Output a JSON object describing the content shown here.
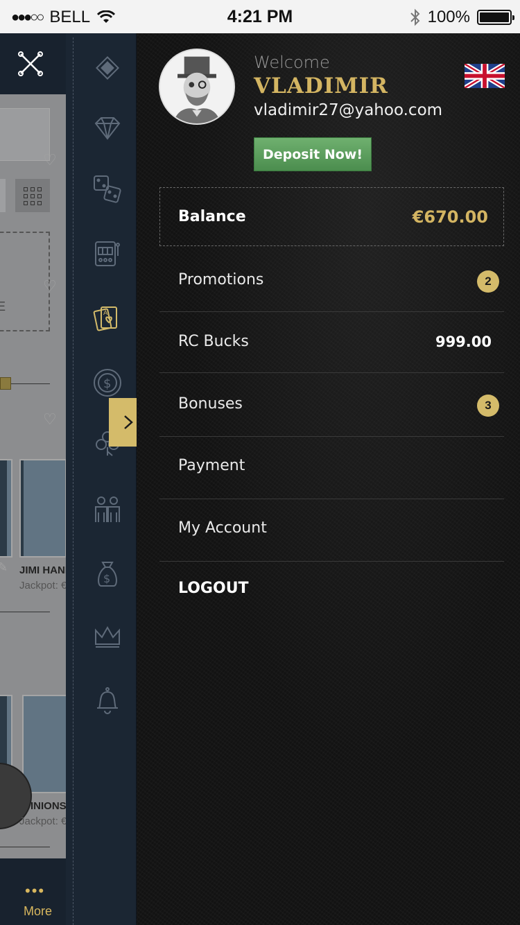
{
  "status_bar": {
    "signal": "●●●○○",
    "carrier": "BELL",
    "time": "4:21 PM",
    "battery_percent": "100%",
    "battery_level": 1.0
  },
  "background_app": {
    "dashed_text": "E",
    "games": [
      {
        "name": "JIMI HANI",
        "jackpot": "Jackpot: €"
      },
      {
        "name": "INIONS",
        "jackpot": "Jackpot: €"
      }
    ],
    "more_dots": "•••",
    "more_label": "More"
  },
  "icon_rail": {
    "icons": [
      "diamond-chip-icon",
      "gem-icon",
      "dice-icon",
      "slot-machine-icon",
      "playing-cards-icon",
      "coin-icon",
      "clover-icon",
      "people-icon",
      "money-bag-icon",
      "crown-icon",
      "bell-icon"
    ],
    "active_icon": "playing-cards-icon",
    "accent_color": "#d4bb6a"
  },
  "profile": {
    "welcome": "Welcome",
    "username": "VLADIMIR",
    "email": "vladimir27@yahoo.com",
    "deposit_label": "Deposit Now!",
    "language_flag": "uk-flag-icon"
  },
  "balance": {
    "label": "Balance",
    "value": "€670.00"
  },
  "menu": {
    "promotions": {
      "label": "Promotions",
      "badge": "2"
    },
    "rc_bucks": {
      "label": "RC Bucks",
      "value": "999.00"
    },
    "bonuses": {
      "label": "Bonuses",
      "badge": "3"
    },
    "payment": {
      "label": "Payment"
    },
    "my_account": {
      "label": "My Account"
    },
    "logout": "LOGOUT"
  },
  "colors": {
    "gold": "#d4b562",
    "deposit_green": "#5a9e5c",
    "rail_bg": "#1b2633",
    "panel_bg": "#141414"
  }
}
